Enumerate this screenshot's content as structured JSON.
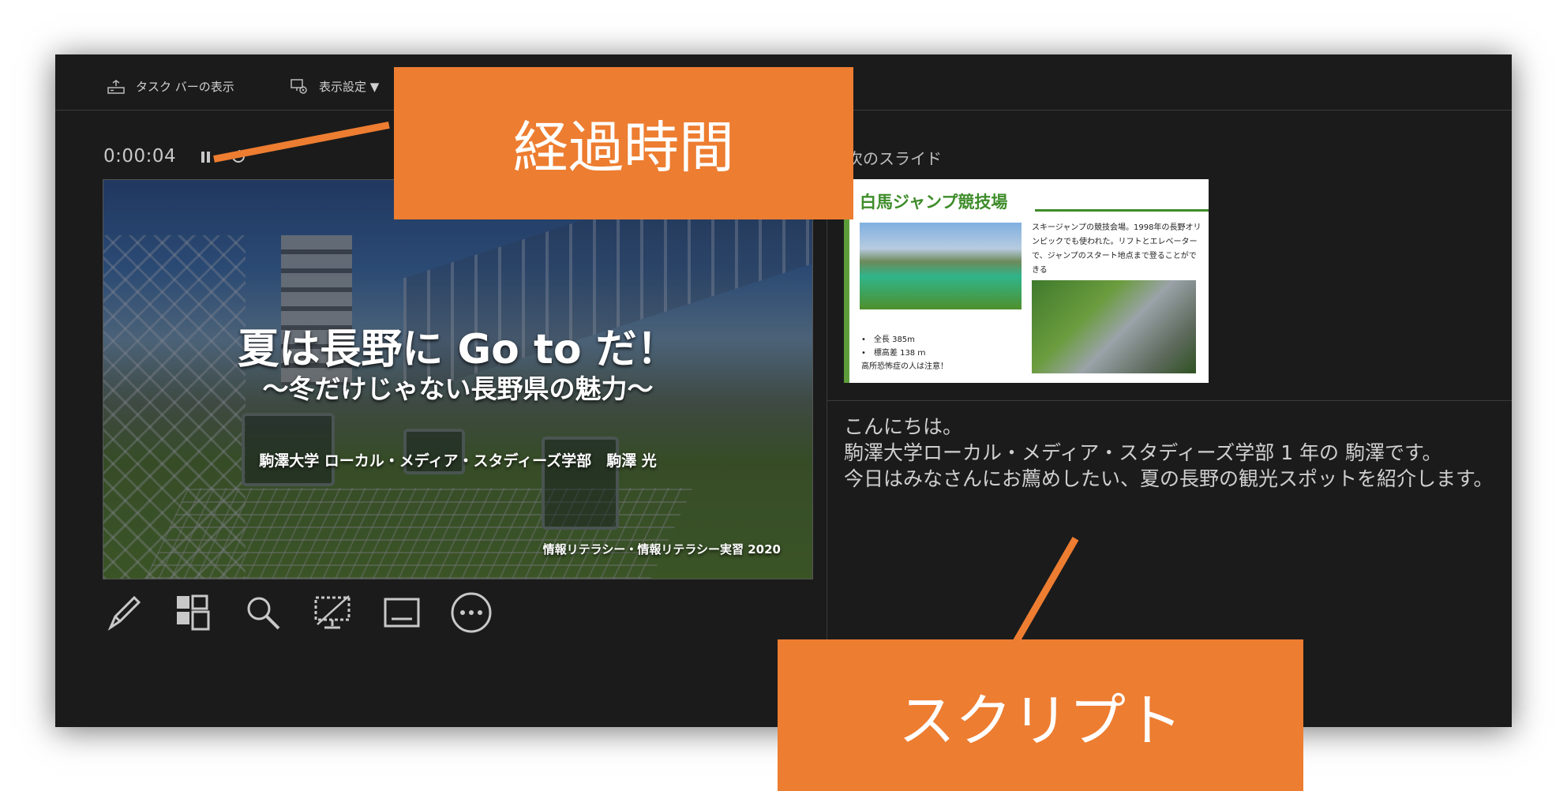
{
  "toolbar": {
    "taskbar_label": "タスク バーの表示",
    "display_settings_label": "表示設定 ▼"
  },
  "timer": {
    "elapsed": "0:00:04"
  },
  "current_slide": {
    "title": "夏は長野に Go to だ！",
    "subtitle": "～冬だけじゃない長野県の魅力～",
    "author": "駒澤大学 ローカル・メディア・スタディーズ学部　駒澤 光",
    "course": "情報リテラシー・情報リテラシー実習 2020"
  },
  "next_slide": {
    "label": "次のスライド",
    "title": "白馬ジャンプ競技場",
    "description": "スキージャンプの競技会場。1998年の長野オリンピックでも使われた。リフトとエレベーターで、ジャンプのスタート地点まで登ることができる",
    "bullets": [
      "全長 385m",
      "標高差 138 ｍ"
    ],
    "note": "高所恐怖症の人は注意！"
  },
  "script": {
    "lines": [
      "こんにちは。",
      "駒澤大学ローカル・メディア・スタディーズ学部 1 年の 駒澤です。",
      "今日はみなさんにお薦めしたい、夏の長野の観光スポットを紹介します。"
    ]
  },
  "callouts": {
    "elapsed": "経過時間",
    "script": "スクリプト"
  },
  "colors": {
    "accent": "#ed7d31",
    "window_bg": "#1b1b1b",
    "slide_green": "#3e8c2a"
  }
}
